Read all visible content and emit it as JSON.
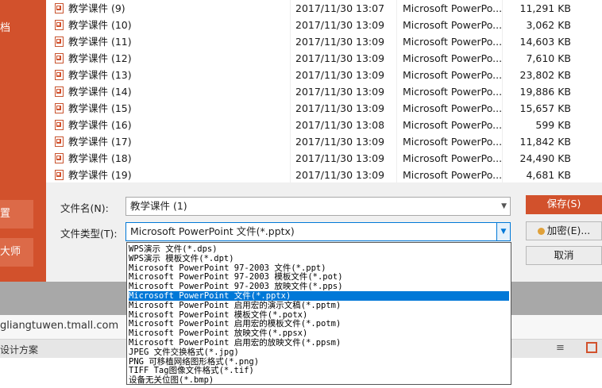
{
  "left_panel": {
    "text_top": "档",
    "button_1": "置",
    "button_2": "大师"
  },
  "files": [
    {
      "name": "教学课件 (9)",
      "date": "2017/11/30 13:07",
      "type": "Microsoft PowerPo...",
      "size": "11,291 KB"
    },
    {
      "name": "教学课件 (10)",
      "date": "2017/11/30 13:09",
      "type": "Microsoft PowerPo...",
      "size": "3,062 KB"
    },
    {
      "name": "教学课件 (11)",
      "date": "2017/11/30 13:09",
      "type": "Microsoft PowerPo...",
      "size": "14,603 KB"
    },
    {
      "name": "教学课件 (12)",
      "date": "2017/11/30 13:09",
      "type": "Microsoft PowerPo...",
      "size": "7,610 KB"
    },
    {
      "name": "教学课件 (13)",
      "date": "2017/11/30 13:09",
      "type": "Microsoft PowerPo...",
      "size": "23,802 KB"
    },
    {
      "name": "教学课件 (14)",
      "date": "2017/11/30 13:09",
      "type": "Microsoft PowerPo...",
      "size": "19,886 KB"
    },
    {
      "name": "教学课件 (15)",
      "date": "2017/11/30 13:09",
      "type": "Microsoft PowerPo...",
      "size": "15,657 KB"
    },
    {
      "name": "教学课件 (16)",
      "date": "2017/11/30 13:08",
      "type": "Microsoft PowerPo...",
      "size": "599 KB"
    },
    {
      "name": "教学课件 (17)",
      "date": "2017/11/30 13:09",
      "type": "Microsoft PowerPo...",
      "size": "11,842 KB"
    },
    {
      "name": "教学课件 (18)",
      "date": "2017/11/30 13:09",
      "type": "Microsoft PowerPo...",
      "size": "24,490 KB"
    },
    {
      "name": "教学课件 (19)",
      "date": "2017/11/30 13:09",
      "type": "Microsoft PowerPo...",
      "size": "4,681 KB"
    }
  ],
  "form": {
    "filename_label": "文件名(N):",
    "filename_value": "教学课件 (1)",
    "filetype_label": "文件类型(T):",
    "filetype_value": "Microsoft PowerPoint 文件(*.pptx)",
    "save_label": "保存(S)",
    "encrypt_label": "加密(E)...",
    "cancel_label": "取消"
  },
  "filetype_options": [
    "WPS演示 文件(*.dps)",
    "WPS演示 模板文件(*.dpt)",
    "Microsoft PowerPoint 97-2003 文件(*.ppt)",
    "Microsoft PowerPoint 97-2003 模板文件(*.pot)",
    "Microsoft PowerPoint 97-2003 放映文件(*.pps)",
    "Microsoft PowerPoint 文件(*.pptx)",
    "Microsoft PowerPoint 启用宏的演示文稿(*.pptm)",
    "Microsoft PowerPoint 模板文件(*.potx)",
    "Microsoft PowerPoint 启用宏的模板文件(*.potm)",
    "Microsoft PowerPoint 放映文件(*.ppsx)",
    "Microsoft PowerPoint 启用宏的放映文件(*.ppsm)",
    "JPEG 文件交换格式(*.jpg)",
    "PNG 可移植网络图形格式(*.png)",
    "TIFF Tag图像文件格式(*.tif)",
    "设备无关位图(*.bmp)"
  ],
  "selected_option_index": 5,
  "background": {
    "url_text": "gliangtuwen.tmall.com",
    "design_text": "设计方案"
  },
  "colors": {
    "accent": "#d2512c",
    "selection": "#0078d7"
  }
}
